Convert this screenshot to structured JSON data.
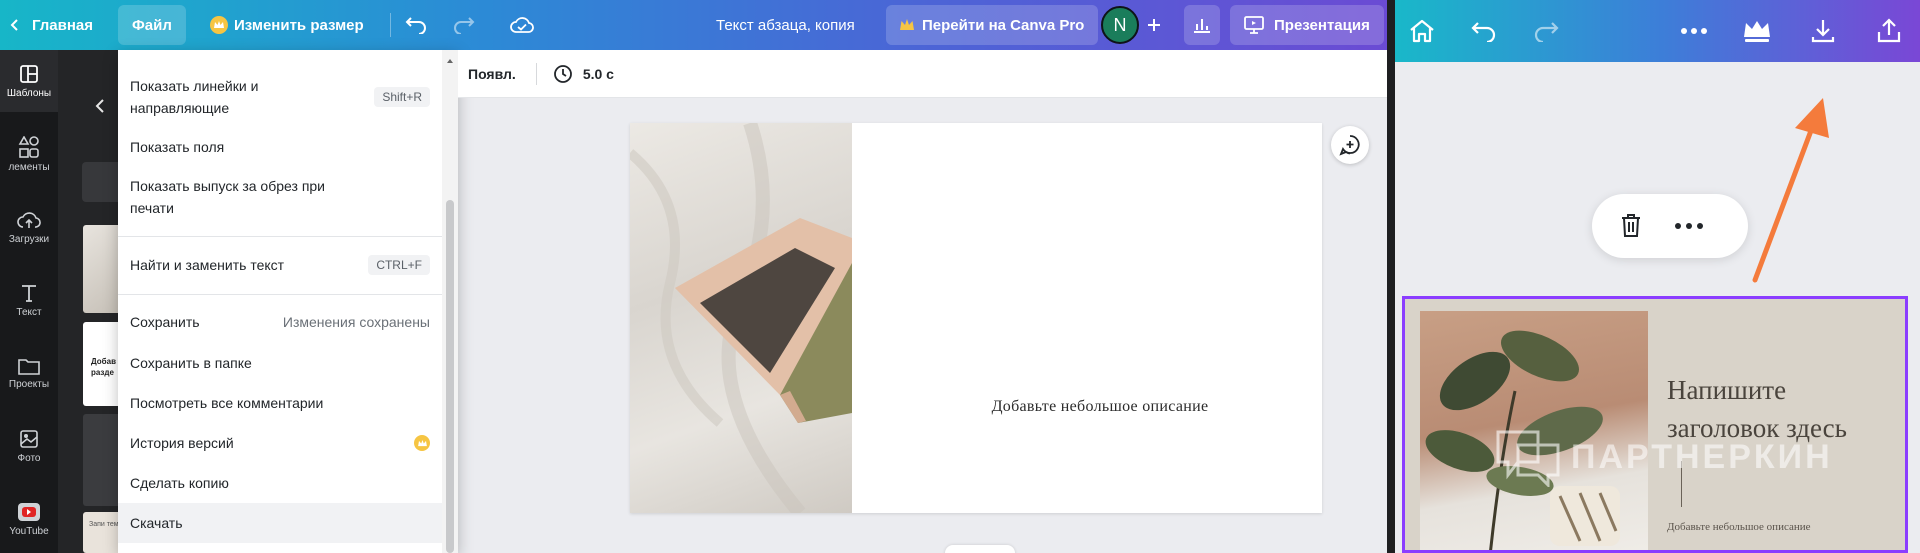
{
  "desktop": {
    "topbar": {
      "home": "Главная",
      "file": "Файл",
      "resize": "Изменить размер",
      "doc_title": "Текст абзаца, копия",
      "pro": "Перейти на Canva Pro",
      "avatar": "N",
      "present": "Презентация"
    },
    "rail": [
      {
        "label": "Шаблоны",
        "icon": "templates-icon"
      },
      {
        "label": "лементы",
        "icon": "elements-icon"
      },
      {
        "label": "Загрузки",
        "icon": "upload-icon"
      },
      {
        "label": "Текст",
        "icon": "text-icon"
      },
      {
        "label": "Проекты",
        "icon": "folder-icon"
      },
      {
        "label": "Фото",
        "icon": "photo-icon"
      },
      {
        "label": "YouTube",
        "icon": "youtube-icon"
      }
    ],
    "file_menu": {
      "show_rulers": "Показать линейки и направляющие",
      "show_rulers_kbd": "Shift+R",
      "show_margins": "Показать поля",
      "show_bleed": "Показать выпуск за обрез при печати",
      "find_replace": "Найти и заменить текст",
      "find_replace_kbd": "CTRL+F",
      "save": "Сохранить",
      "save_status": "Изменения сохранены",
      "save_folder": "Сохранить в папке",
      "view_comments": "Посмотреть все комментарии",
      "history": "История версий",
      "copy": "Сделать копию",
      "download": "Скачать"
    },
    "subbar": {
      "animation": "Появл.",
      "duration": "5.0 с"
    },
    "slide": {
      "description": "Добавьте небольшое описание"
    },
    "thumbs": [
      {
        "text": "Добав разде"
      },
      {
        "text": "Запи тему"
      }
    ]
  },
  "mobile": {
    "card_title": "Напишите заголовок здесь",
    "card_desc": "Добавьте небольшое описание",
    "watermark": "ПАРТНЕРКИН",
    "colors": {
      "selection": "#8b3dff",
      "arrow": "#f47b3c"
    }
  }
}
